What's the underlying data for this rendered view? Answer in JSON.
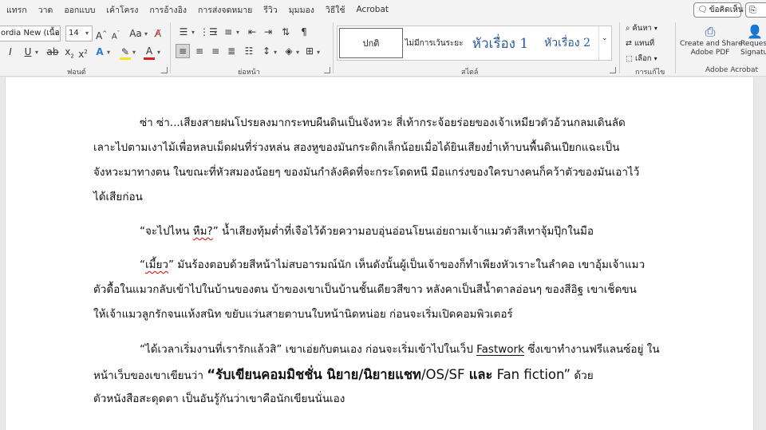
{
  "menu": {
    "tabs": [
      "แทรก",
      "วาด",
      "ออกแบบ",
      "เค้าโครง",
      "การอ้างอิง",
      "การส่งจดหมาย",
      "รีวิว",
      "มุมมอง",
      "วิธีใช้",
      "Acrobat"
    ],
    "comments_label": "ข้อคิดเห็น"
  },
  "ribbon": {
    "font": {
      "name": "ordia New (เนื้อความ",
      "size": "14",
      "group_label": "ฟอนต์"
    },
    "paragraph": {
      "group_label": "ย่อหน้า"
    },
    "styles": {
      "group_label": "สไตล์",
      "items": [
        "ปกติ",
        "ไม่มีการเว้นระยะ",
        "หัวเรื่อง 1",
        "หัวเรื่อง 2"
      ]
    },
    "editing": {
      "group_label": "การแก้ไข",
      "find_label": "ค้นหา",
      "replace_label": "แทนที่",
      "select_label": "เลือก"
    },
    "acrobat": {
      "group_label": "Adobe Acrobat",
      "create_share_line1": "Create and Share",
      "create_share_line2": "Adobe PDF",
      "request_line1": "Reques",
      "request_line2": "Signatur"
    },
    "colors": {
      "highlight": "#f5e51b",
      "font_color": "#d81e1e",
      "accent": "#2b5a9a"
    }
  },
  "document": {
    "p1": {
      "l1": "ซ่า ซ่า...เสียงสายฝนโปรยลงมากระทบผืนดินเป็นจังหวะ สี่เท้ากระจ้อยร่อยของเจ้าเหมียวตัวอ้วนกลมเดินลัด",
      "l2": "เลาะไปตามเงาไม้เพื่อหลบเม็ดฝนที่ร่วงหล่น สองหูของมันกระดิกเล็กน้อยเมื่อได้ยินเสียงย่ำเท้าบนพื้นดินเปียกแฉะเป็น",
      "l3": "จังหวะมาทางตน ในขณะที่หัวสมองน้อยๆ ของมันกำลังคิดที่จะกระโดดหนี มือแกร่งของใครบางคนก็คว้าตัวของมันเอาไว้",
      "l4": "ได้เสียก่อน"
    },
    "p2": {
      "a": "“จะไปไหน ",
      "b": "หืม?",
      "c": "” น้ำเสียงทุ้มต่ำที่เจือไว้ด้วยความอบอุ่นอ่อนโยนเอ่ยถามเจ้าแมวตัวสีเทาจุ้มปุ๊กในมือ"
    },
    "p3": {
      "a": "“",
      "b": "เมี้ยว",
      "c": "” มันร้องตอบด้วยสีหน้าไม่สบอารมณ์นัก เห็นดังนั้นผู้เป็นเจ้าของก็ทำเพียงหัวเราะในลำคอ เขาอุ้มเจ้าแมว",
      "l2": "ตัวดื้อในแมวกลับเข้าไปในบ้านของตน บ้าของเขาเป็นบ้านชั้นเดียวสีขาว หลังคาเป็นสีน้ำตาลอ่อนๆ ของสีอิฐ เขาเช็ดขน",
      "l3": "ให้เจ้าแมวลูกรักจนแห้งสนิท ขยับแว่นสายตาบนใบหน้านิดหน่อย ก่อนจะเริ่มเปิดคอมพิวเตอร์"
    },
    "p4": {
      "a": "“ได้เวลาเริ่มงานที่เรารักแล้วสิ” เขาเอ่ยกับตนเอง ก่อนจะเริ่มเข้าไปในเว็ป ",
      "b": "Fastwork",
      "c": " ซึ่งเขาทำงานฟรีแลนซ์อยู่ ใน",
      "l2a": "หน้าเว็บของเขาเขียนว่า ",
      "l2b": "“รับเขียนคอมมิชชั่น นิยาย/นิยายแชท",
      "l2c": "/OS/SF ",
      "l2d": "และ",
      "l2e": " Fan fiction”",
      "l2f": " ด้วย",
      "l3": "ตัวหนังสือสะดุดตา เป็นอันรู้กันว่าเขาคือนักเขียนนั่นเอง"
    }
  }
}
